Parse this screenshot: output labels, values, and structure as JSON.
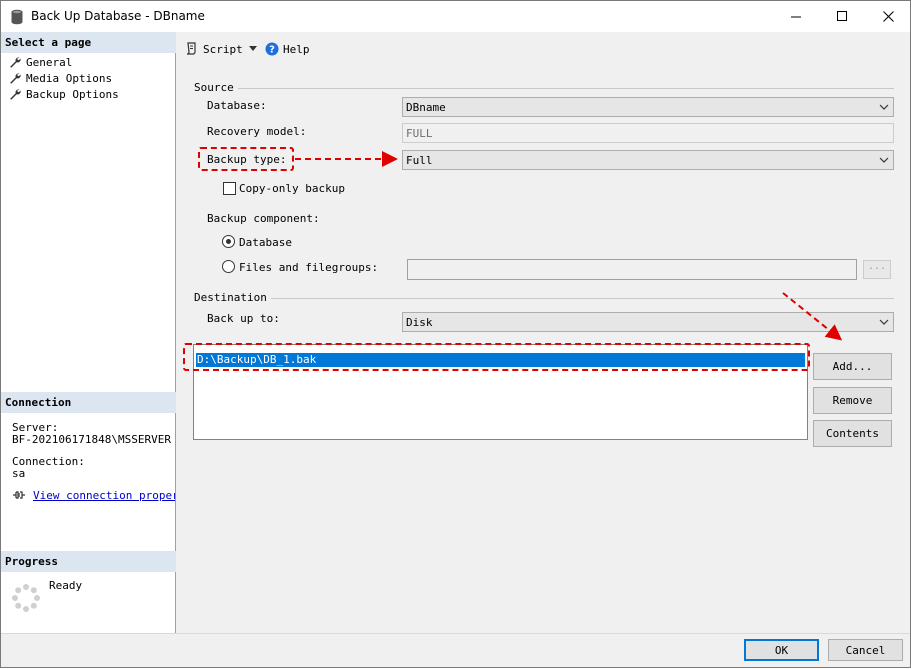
{
  "window": {
    "title": "Back Up Database - DBname"
  },
  "left_pane": {
    "select_page_header": "Select a page",
    "pages": [
      {
        "label": "General"
      },
      {
        "label": "Media Options"
      },
      {
        "label": "Backup Options"
      }
    ],
    "connection_header": "Connection",
    "server_label": "Server:",
    "server_value": "BF-202106171848\\MSSERVER",
    "connection_label": "Connection:",
    "connection_value": "sa",
    "view_connection_link": "View connection properti",
    "progress_header": "Progress",
    "progress_status": "Ready"
  },
  "toolbar": {
    "script_label": "Script",
    "help_label": "Help"
  },
  "source": {
    "group_label": "Source",
    "database_label": "Database:",
    "database_value": "DBname",
    "recovery_model_label": "Recovery model:",
    "recovery_model_value": "FULL",
    "backup_type_label": "Backup type:",
    "backup_type_value": "Full",
    "copy_only_label": "Copy-only backup",
    "copy_only_checked": false,
    "backup_component_label": "Backup component:",
    "component_database_label": "Database",
    "component_files_label": "Files and filegroups:",
    "browse_label": "...",
    "selected_component": "Database"
  },
  "destination": {
    "group_label": "Destination",
    "back_up_to_label": "Back up to:",
    "back_up_to_value": "Disk",
    "files": [
      "D:\\Backup\\DB_1.bak"
    ],
    "add_button": "Add...",
    "remove_button": "Remove",
    "contents_button": "Contents"
  },
  "footer": {
    "ok_button": "OK",
    "cancel_button": "Cancel"
  },
  "colors": {
    "annotation": "#e00000",
    "selection": "#0078d7",
    "header_bg": "#dce6f0"
  }
}
